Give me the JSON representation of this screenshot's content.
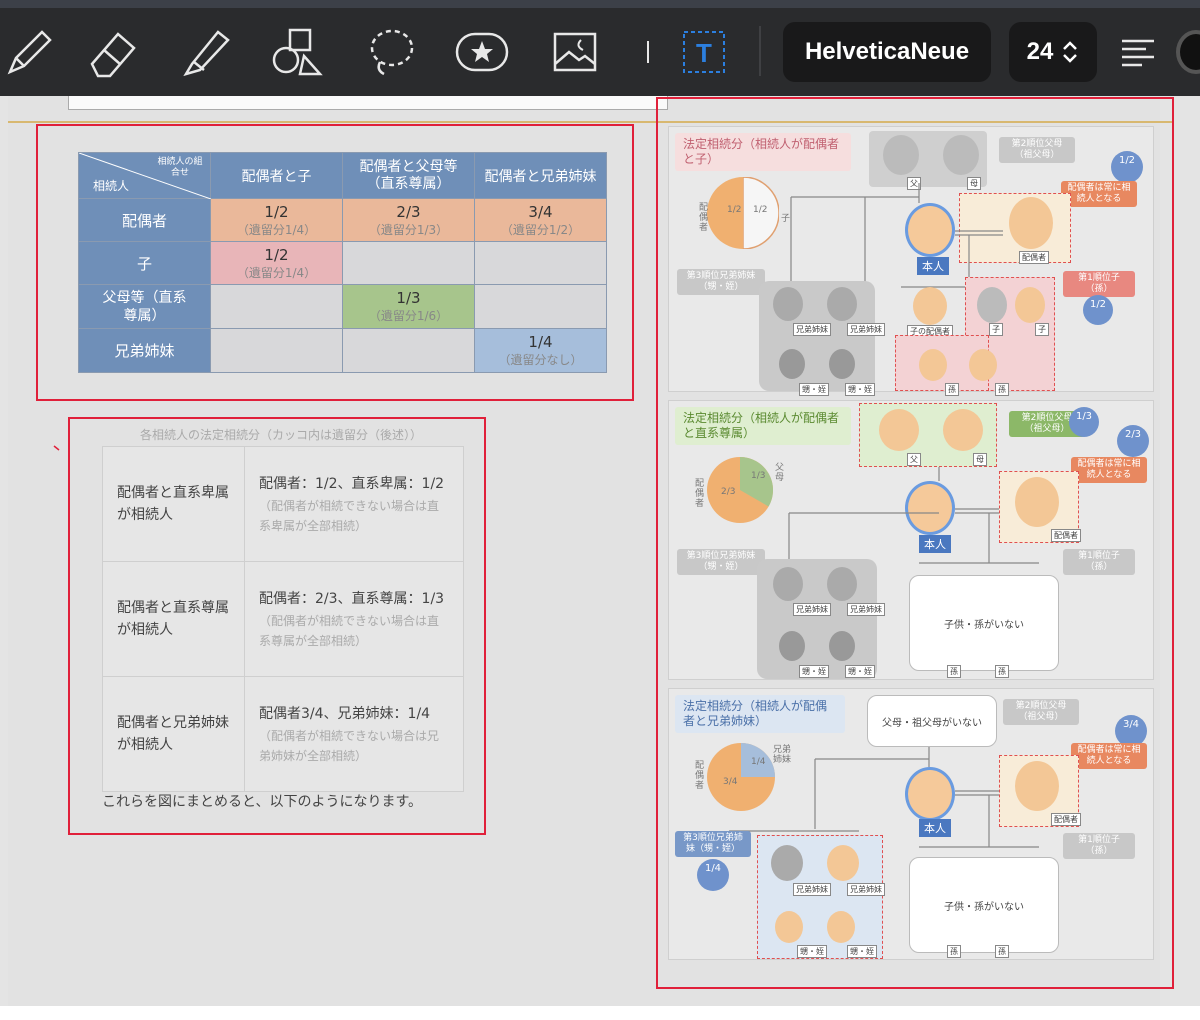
{
  "toolbar": {
    "font_name": "HelveticaNeue",
    "font_size": "24",
    "icons": [
      "pen-icon",
      "eraser-icon",
      "highlighter-icon",
      "shapes-icon",
      "lasso-icon",
      "sticker-icon",
      "image-icon",
      "text-tool-icon",
      "paragraph-icon"
    ]
  },
  "table1": {
    "corner_top": "相続人の組合せ",
    "corner_bottom": "相続人",
    "columns": [
      "配偶者と子",
      "配偶者と父母等（直系尊属）",
      "配偶者と兄弟姉妹"
    ],
    "rows": [
      {
        "label": "配偶者",
        "cells": [
          {
            "v": "1/2",
            "s": "（遺留分1/4）"
          },
          {
            "v": "2/3",
            "s": "（遺留分1/3）"
          },
          {
            "v": "3/4",
            "s": "（遺留分1/2）"
          }
        ]
      },
      {
        "label": "子",
        "cells": [
          {
            "v": "1/2",
            "s": "（遺留分1/4）"
          },
          {
            "v": "",
            "s": ""
          },
          {
            "v": "",
            "s": ""
          }
        ]
      },
      {
        "label": "父母等（直系尊属）",
        "cells": [
          {
            "v": "",
            "s": ""
          },
          {
            "v": "1/3",
            "s": "（遺留分1/6）"
          },
          {
            "v": "",
            "s": ""
          }
        ]
      },
      {
        "label": "兄弟姉妹",
        "cells": [
          {
            "v": "",
            "s": ""
          },
          {
            "v": "",
            "s": ""
          },
          {
            "v": "1/4",
            "s": "（遺留分なし）"
          }
        ]
      }
    ]
  },
  "table2": {
    "caption": "各相続人の法定相続分（カッコ内は遺留分（後述））",
    "rows": [
      {
        "left": "配偶者と直系卑属が相続人",
        "main": "配偶者：1/2、直系卑属：1/2",
        "note": "（配偶者が相続できない場合は直系卑属が全部相続）"
      },
      {
        "left": "配偶者と直系尊属が相続人",
        "main": "配偶者：2/3、直系尊属：1/3",
        "note": "（配偶者が相続できない場合は直系尊属が全部相続）"
      },
      {
        "left": "配偶者と兄弟姉妹が相続人",
        "main": "配偶者3/4、兄弟姉妹：1/4",
        "note": "（配偶者が相続できない場合は兄弟姉妹が全部相続）"
      }
    ],
    "summary": "これらを図にまとめると、以下のようになります。"
  },
  "diagrams": {
    "p1": {
      "title": "法定相続分（相続人が配偶者と子）",
      "spouse_label": "配偶者",
      "child_label": "子",
      "frac_left": "1/2",
      "frac_right": "1/2",
      "rank2": "第2順位父母（祖父母）",
      "father": "父",
      "mother": "母",
      "badge_top": "1/2",
      "always": "配偶者は常に相続人となる",
      "honnin": "本人",
      "spouse": "配偶者",
      "rank3": "第3順位兄弟姉妹（甥・姪）",
      "rank1": "第1順位子（孫）",
      "badge_child": "1/2",
      "sibling": "兄弟姉妹",
      "child_spouse": "子の配偶者",
      "child": "子",
      "nephew": "甥・姪",
      "grandchild": "孫"
    },
    "p2": {
      "title": "法定相続分（相続人が配偶者と直系尊属）",
      "spouse_label": "配偶者",
      "parent_label": "父母",
      "frac_left": "2/3",
      "frac_right": "1/3",
      "rank2": "第2順位父母（祖父母）",
      "father": "父",
      "mother": "母",
      "badge_parent": "1/3",
      "badge_spouse": "2/3",
      "always": "配偶者は常に相続人となる",
      "honnin": "本人",
      "spouse": "配偶者",
      "rank3": "第3順位兄弟姉妹（甥・姪）",
      "rank1": "第1順位子（孫）",
      "sibling": "兄弟姉妹",
      "nochild": "子供・孫がいない",
      "nephew": "甥・姪",
      "grandchild": "孫"
    },
    "p3": {
      "title": "法定相続分（相続人が配偶者と兄弟姉妹）",
      "spouse_label": "配偶者",
      "sib_label": "兄弟姉妹",
      "frac_left": "3/4",
      "frac_right": "1/4",
      "noparent": "父母・祖父母がいない",
      "rank2": "第2順位父母（祖父母）",
      "badge_spouse": "3/4",
      "always": "配偶者は常に相続人となる",
      "honnin": "本人",
      "spouse": "配偶者",
      "rank3": "第3順位兄弟姉妹（甥・姪）",
      "rank1": "第1順位子（孫）",
      "badge_sib": "1/4",
      "sibling": "兄弟姉妹",
      "nochild": "子供・孫がいない",
      "nephew": "甥・姪",
      "grandchild": "孫"
    }
  }
}
